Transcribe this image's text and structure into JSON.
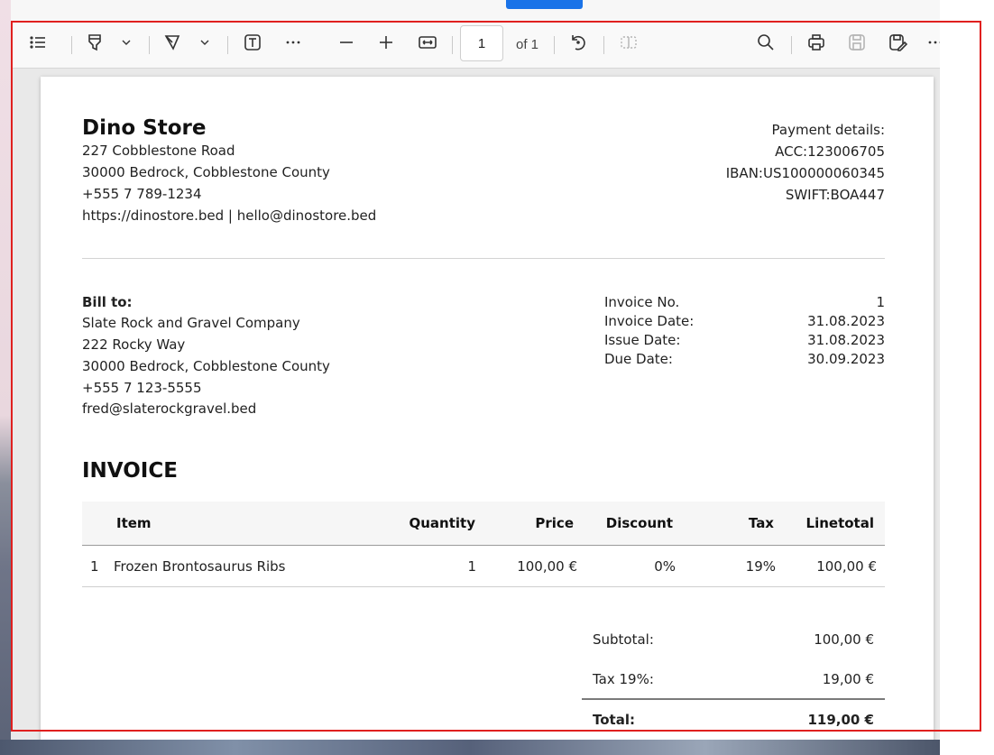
{
  "toolbar": {
    "page_current": "1",
    "page_of": "of 1",
    "icons": [
      "contents-icon",
      "highlight-icon",
      "chevron-down-icon",
      "draw-icon",
      "chevron-down-icon",
      "text-icon",
      "more-icon",
      "zoom-out-icon",
      "zoom-in-icon",
      "fit-width-icon",
      "rotate-icon",
      "page-view-icon",
      "search-icon",
      "print-icon",
      "save-icon",
      "save-as-icon",
      "more-icon"
    ]
  },
  "invoice": {
    "store": {
      "name": "Dino Store",
      "address1": "227 Cobblestone Road",
      "address2": "30000 Bedrock, Cobblestone County",
      "phone": "+555 7 789-1234",
      "web_email": "https://dinostore.bed | hello@dinostore.bed"
    },
    "payment": {
      "title": "Payment details:",
      "acc": "ACC:123006705",
      "iban": "IBAN:US100000060345",
      "swift": "SWIFT:BOA447"
    },
    "bill_to": {
      "title": "Bill to:",
      "name": "Slate Rock and Gravel Company",
      "address1": "222 Rocky Way",
      "address2": "30000 Bedrock, Cobblestone County",
      "phone": "+555 7 123-5555",
      "email": "fred@slaterockgravel.bed"
    },
    "meta": {
      "no_label": "Invoice No.",
      "no_value": "1",
      "date_label": "Invoice Date:",
      "date_value": "31.08.2023",
      "issue_label": "Issue Date:",
      "issue_value": "31.08.2023",
      "due_label": "Due Date:",
      "due_value": "30.09.2023"
    },
    "heading": "INVOICE",
    "table": {
      "headers": {
        "item": "Item",
        "quantity": "Quantity",
        "price": "Price",
        "discount": "Discount",
        "tax": "Tax",
        "linetotal": "Linetotal"
      },
      "rows": [
        {
          "index": "1",
          "item": "Frozen Brontosaurus Ribs",
          "quantity": "1",
          "price": "100,00 €",
          "discount": "0%",
          "tax": "19%",
          "linetotal": "100,00 €"
        }
      ]
    },
    "totals": {
      "subtotal_label": "Subtotal:",
      "subtotal_value": "100,00 €",
      "tax_label": "Tax 19%:",
      "tax_value": "19,00 €",
      "total_label": "Total:",
      "total_value": "119,00 €"
    }
  },
  "colors": {
    "highlight_frame": "#e0201f",
    "top_button": "#1a73e8"
  }
}
